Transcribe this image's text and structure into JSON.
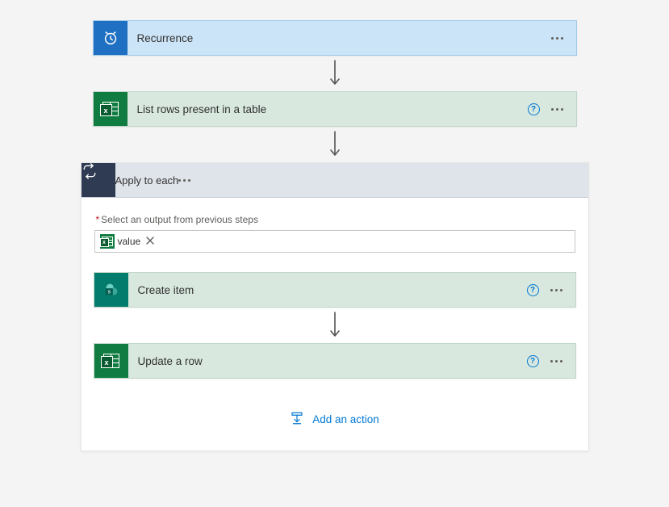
{
  "step1": {
    "title": "Recurrence"
  },
  "step2": {
    "title": "List rows present in a table"
  },
  "loop": {
    "title": "Apply to each",
    "field_label": "Select an output from previous steps",
    "token_value": "value"
  },
  "inner1": {
    "title": "Create item"
  },
  "inner2": {
    "title": "Update a row"
  },
  "add_action_label": "Add an action"
}
